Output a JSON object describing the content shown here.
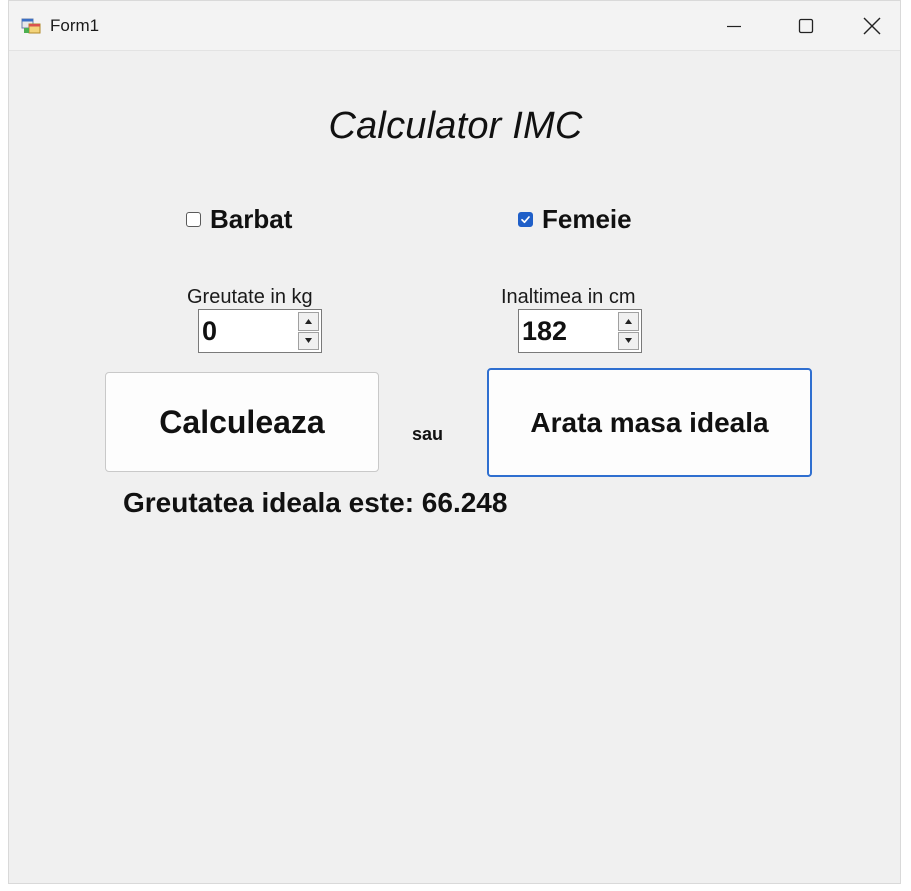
{
  "window": {
    "title": "Form1",
    "app_icon": "winforms-app-icon",
    "controls": {
      "minimize": "minimize-icon",
      "maximize": "maximize-icon",
      "close": "close-icon"
    }
  },
  "form": {
    "heading": "Calculator IMC",
    "gender": {
      "male_label": "Barbat",
      "male_checked": false,
      "female_label": "Femeie",
      "female_checked": true
    },
    "weight": {
      "label": "Greutate in kg",
      "value": "0"
    },
    "height": {
      "label": "Inaltimea in cm",
      "value": "182"
    },
    "calculate_button": "Calculeaza",
    "or_label": "sau",
    "ideal_button": "Arata masa ideala",
    "result": "Greutatea ideala este: 66.248"
  },
  "colors": {
    "accent": "#1f5fc8",
    "window_bg": "#f0f0f0"
  }
}
